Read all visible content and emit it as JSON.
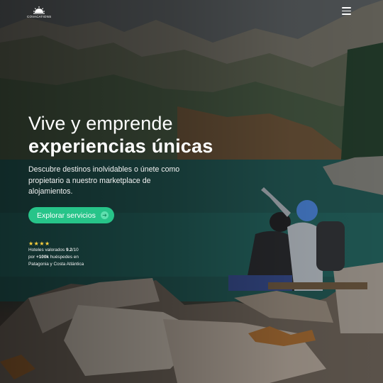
{
  "brand": {
    "name": "COVACATIONS",
    "logo_icon": "sunrise-icon"
  },
  "nav": {
    "menu_icon": "hamburger-menu-icon"
  },
  "hero": {
    "title_line1": "Vive y emprende",
    "title_line2": "experiencias únicas",
    "subtitle": "Descubre destinos inolvidables o únete como propietario a nuestro marketplace de alojamientos.",
    "cta_label": "Explorar servicios",
    "cta_icon": "arrow-right-icon"
  },
  "rating": {
    "stars": "★★★★",
    "star_count": 4,
    "line1_prefix": "Hoteles valorados ",
    "line1_score": "9.2",
    "line1_suffix": "/10",
    "line2_prefix": "por ",
    "line2_count": "+100k",
    "line2_suffix": " huéspedes en",
    "line3": "Patagonia y Costa Atlántica"
  },
  "colors": {
    "accent": "#27c489",
    "star": "#ffd23e",
    "text": "#ffffff"
  }
}
